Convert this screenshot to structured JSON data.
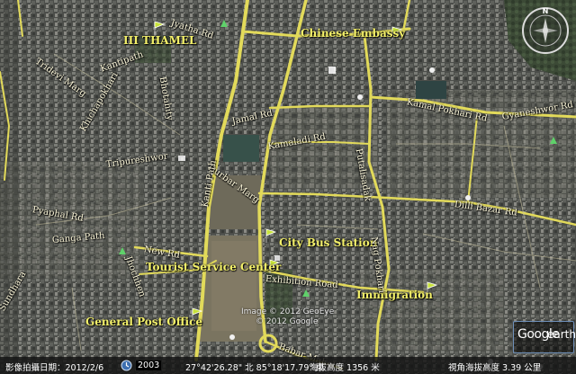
{
  "map": {
    "place_markers": [
      {
        "name": "III THAMEL"
      },
      {
        "name": "Chinese Embassy"
      },
      {
        "name": "City Bus Station"
      },
      {
        "name": "Tourist Service Center"
      },
      {
        "name": "Immigration"
      },
      {
        "name": "General Post Office"
      }
    ],
    "road_labels": [
      "Jyatha Rd",
      "Tridevi Marg",
      "Kantipath",
      "Jamal Rd",
      "Kamaladi Rd",
      "Kamal Pokhari Rd",
      "Gyaneshwor Rd",
      "Putalisadak",
      "Dilli Bazar Rd",
      "Tripureshwor",
      "Pyaphal Rd",
      "Ganga Path",
      "Jhochhen",
      "New Rd",
      "Sundhara",
      "Bhotahity",
      "Durbar Marg",
      "Exhibition Road",
      "Babar Mahal",
      "Nag Pokhari",
      "Kanti Path",
      "Khichapokhari"
    ],
    "copyright_lines": [
      "Image © 2012 GeoEye",
      "© 2012 Google"
    ],
    "colors": {
      "road": "#e8e05a",
      "label": "#f3f06a",
      "park": "#4a6a4a"
    }
  },
  "statusbar": {
    "imagery_date": "影像拍攝日期：2012/2/6",
    "year": "2003",
    "coordinates": "27°42'26.28\" 北  85°18'17.79\" 東",
    "elevation": "海拔高度 1356 米",
    "eye_altitude": "視角海拔高度   3.39 公里"
  },
  "logo": {
    "text_google": "Google",
    "text_earth": "earth"
  },
  "compass": {
    "north_letter": "N"
  }
}
